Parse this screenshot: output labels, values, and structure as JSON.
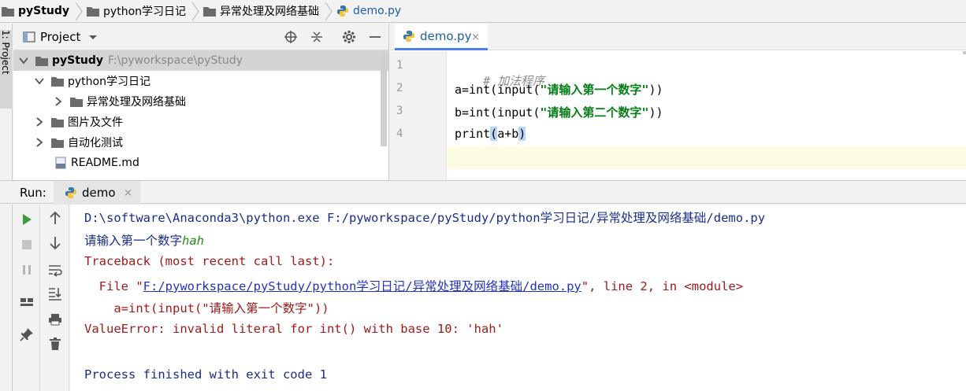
{
  "breadcrumb": {
    "root": "pyStudy",
    "folder1": "python学习日记",
    "folder2": "异常处理及网络基础",
    "file": "demo.py"
  },
  "left_strip": {
    "label": "1: Project"
  },
  "project_panel": {
    "title": "Project",
    "tree": {
      "root_name": "pyStudy",
      "root_path": "F:\\pyworkspace\\pyStudy",
      "items": [
        {
          "label": "python学习日记"
        },
        {
          "label": "异常处理及网络基础"
        },
        {
          "label": "图片及文件"
        },
        {
          "label": "自动化测试"
        },
        {
          "label": "README.md"
        }
      ]
    }
  },
  "editor": {
    "tab": {
      "label": "demo.py",
      "close": "×"
    },
    "line_numbers": [
      "1",
      "2",
      "3",
      "4"
    ],
    "lines": {
      "l1_comment": "# 加法程序",
      "l2_pre": "a=int(input(",
      "l2_str": "\"请输入第一个数字\"",
      "l2_post": "))",
      "l3_pre": "b=int(input(",
      "l3_str": "\"请输入第二个数字\"",
      "l3_post": "))",
      "l4_pre": "print",
      "l4_open": "(",
      "l4_mid": "a+b",
      "l4_close": ")"
    }
  },
  "run": {
    "label": "Run:",
    "tab_label": "demo",
    "tab_close": "×"
  },
  "console": {
    "cmd": "D:\\software\\Anaconda3\\python.exe F:/pyworkspace/pyStudy/python学习日记/异常处理及网络基础/demo.py",
    "prompt": "请输入第一个数字",
    "user_input": "hah",
    "traceback": "Traceback (most recent call last):",
    "file_pre": "  File \"",
    "file_link": "F:/pyworkspace/pyStudy/python学习日记/异常处理及网络基础/demo.py",
    "file_post": "\", line 2, in <module>",
    "code": "    a=int(input(\"请输入第一个数字\"))",
    "error": "ValueError: invalid literal for int() with base 10: 'hah'",
    "finished": "Process finished with exit code 1"
  },
  "colors": {
    "accent": "#4e80ea",
    "run_green": "#3d9b3d",
    "error_red": "#a11a1a",
    "link_blue": "#2433b5"
  }
}
